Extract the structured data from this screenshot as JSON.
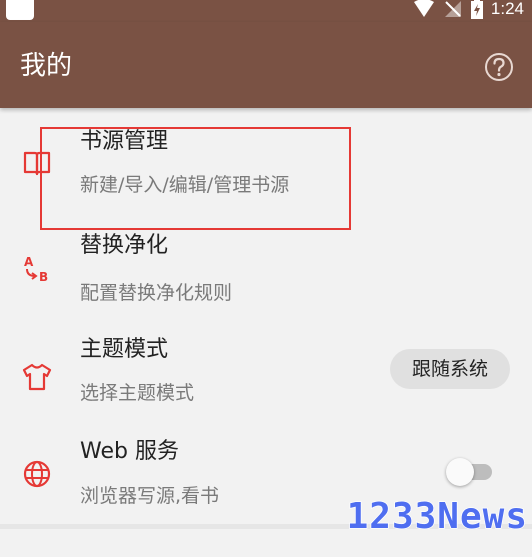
{
  "status_bar": {
    "time": "1:24"
  },
  "app_bar": {
    "title": "我的",
    "help_icon": "help-circle-icon"
  },
  "items": [
    {
      "title": "书源管理",
      "subtitle": "新建/导入/编辑/管理书源",
      "icon": "book-open-icon"
    },
    {
      "title": "替换净化",
      "subtitle": "配置替换净化规则",
      "icon": "replace-ab-icon"
    },
    {
      "title": "主题模式",
      "subtitle": "选择主题模式",
      "icon": "tshirt-icon",
      "control_label": "跟随系统"
    },
    {
      "title": "Web 服务",
      "subtitle": "浏览器写源,看书",
      "icon": "globe-icon",
      "switch_on": false
    }
  ],
  "watermark": "1233News",
  "colors": {
    "app_bar": "#7a5244",
    "accent": "#e53935",
    "watermark": "#4f6ef0"
  }
}
